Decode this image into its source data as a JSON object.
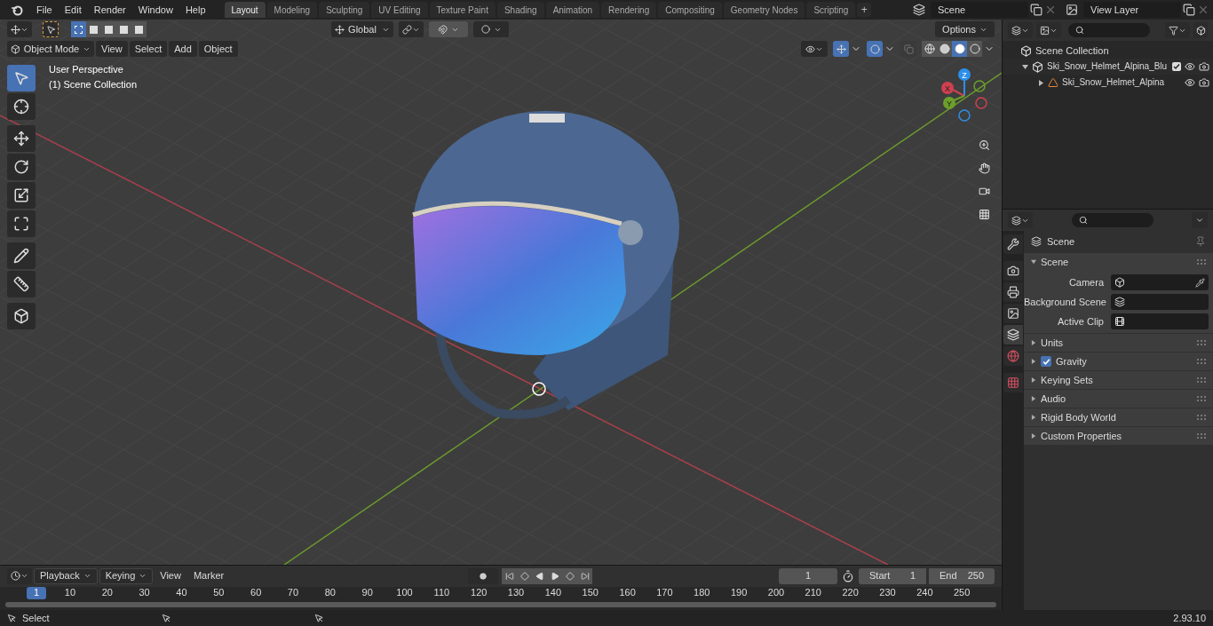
{
  "top_menu": [
    "File",
    "Edit",
    "Render",
    "Window",
    "Help"
  ],
  "workspaces": [
    {
      "label": "Layout",
      "selected": true
    },
    {
      "label": "Modeling",
      "selected": false
    },
    {
      "label": "Sculpting",
      "selected": false
    },
    {
      "label": "UV Editing",
      "selected": false
    },
    {
      "label": "Texture Paint",
      "selected": false
    },
    {
      "label": "Shading",
      "selected": false
    },
    {
      "label": "Animation",
      "selected": false
    },
    {
      "label": "Rendering",
      "selected": false
    },
    {
      "label": "Compositing",
      "selected": false
    },
    {
      "label": "Geometry Nodes",
      "selected": false
    },
    {
      "label": "Scripting",
      "selected": false
    }
  ],
  "add_workspace": "+",
  "scene": "Scene",
  "view_layer": "View Layer",
  "viewport": {
    "select_modes": [
      {
        "kind": "new",
        "selected": true
      },
      {
        "kind": "extend",
        "selected": false
      },
      {
        "kind": "subtract",
        "selected": false
      },
      {
        "kind": "invert",
        "selected": false
      },
      {
        "kind": "intersect",
        "selected": false
      }
    ],
    "orientation": "Global",
    "options": "Options",
    "mode": "Object Mode",
    "menus": [
      "View",
      "Select",
      "Add",
      "Object"
    ],
    "info": [
      "User Perspective",
      "(1) Scene Collection"
    ],
    "tools": [
      {
        "kind": "select",
        "selected": true
      },
      {
        "kind": "cursor",
        "selected": false
      },
      {
        "kind": "move",
        "selected": false
      },
      {
        "kind": "rotate",
        "selected": false
      },
      {
        "kind": "scale",
        "selected": false
      },
      {
        "kind": "transform",
        "selected": false
      },
      {
        "kind": "annotate",
        "selected": false
      },
      {
        "kind": "measure",
        "selected": false
      },
      {
        "kind": "add-cube",
        "selected": false
      }
    ],
    "show_gizmos": true,
    "show_overlays": true,
    "shading": [
      {
        "kind": "wireframe",
        "selected": false
      },
      {
        "kind": "solid",
        "selected": false
      },
      {
        "kind": "material",
        "selected": true
      },
      {
        "kind": "rendered",
        "selected": false
      }
    ],
    "gizmo_axes": [
      "X",
      "Y",
      "Z"
    ]
  },
  "outliner": {
    "root": "Scene Collection",
    "items": [
      {
        "label": "Ski_Snow_Helmet_Alpina_Blu",
        "kind": "collection",
        "expanded": true,
        "checked": true,
        "children": [
          {
            "label": "Ski_Snow_Helmet_Alpina",
            "kind": "object",
            "expanded": false
          }
        ]
      }
    ]
  },
  "properties": {
    "tabs": [
      {
        "kind": "tool",
        "selected": false
      },
      {
        "kind": "render",
        "selected": false
      },
      {
        "kind": "output",
        "selected": false
      },
      {
        "kind": "view-layer",
        "selected": false
      },
      {
        "kind": "scene",
        "selected": true
      },
      {
        "kind": "world",
        "selected": false
      },
      {
        "kind": "texture",
        "selected": false
      }
    ],
    "context": "Scene",
    "panels": [
      {
        "label": "Scene",
        "expanded": true,
        "fields": [
          {
            "label": "Camera",
            "kind": "camera"
          },
          {
            "label": "Background Scene",
            "kind": "scene"
          },
          {
            "label": "Active Clip",
            "kind": "clip"
          }
        ]
      },
      {
        "label": "Units",
        "expanded": false
      },
      {
        "label": "Gravity",
        "expanded": false,
        "checked": true
      },
      {
        "label": "Keying Sets",
        "expanded": false
      },
      {
        "label": "Audio",
        "expanded": false
      },
      {
        "label": "Rigid Body World",
        "expanded": false
      },
      {
        "label": "Custom Properties",
        "expanded": false
      }
    ]
  },
  "timeline": {
    "menus": [
      {
        "label": "Playback",
        "kind": "dropdown"
      },
      {
        "label": "Keying",
        "kind": "dropdown"
      },
      {
        "label": "View",
        "kind": "menu"
      },
      {
        "label": "Marker",
        "kind": "menu"
      }
    ],
    "current_frame": "1",
    "start_label": "Start",
    "start": "1",
    "end_label": "End",
    "end": "250",
    "ruler_current": "1",
    "ruler_ticks": [
      "10",
      "20",
      "30",
      "40",
      "50",
      "60",
      "70",
      "80",
      "90",
      "100",
      "110",
      "120",
      "130",
      "140",
      "150",
      "160",
      "170",
      "180",
      "190",
      "200",
      "210",
      "220",
      "230",
      "240",
      "250"
    ]
  },
  "status_bar": {
    "hint": "Select",
    "version": "2.93.10"
  }
}
